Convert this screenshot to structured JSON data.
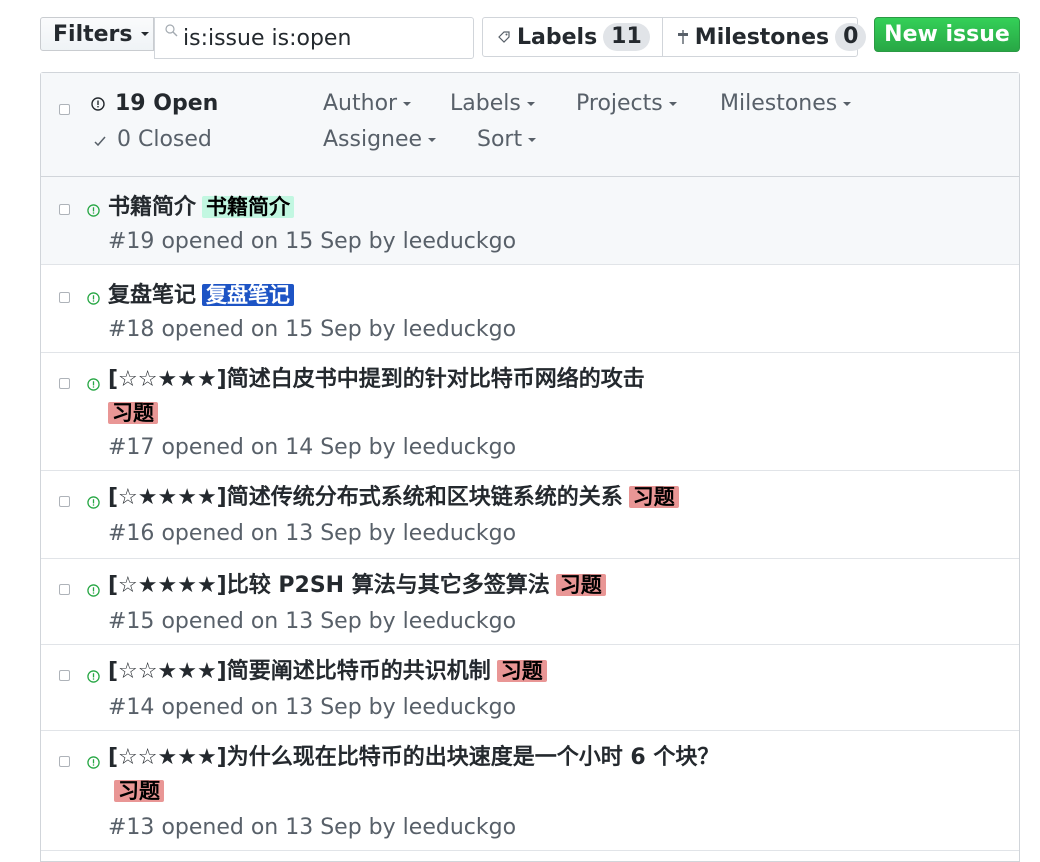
{
  "toolbar": {
    "filters_label": "Filters",
    "search_value": "is:issue is:open",
    "labels_label": "Labels",
    "labels_count": "11",
    "milestones_label": "Milestones",
    "milestones_count": "0",
    "new_issue_label": "New issue"
  },
  "header": {
    "open_label": "19 Open",
    "closed_label": "0 Closed",
    "filters": {
      "author": "Author",
      "labels": "Labels",
      "projects": "Projects",
      "milestones": "Milestones",
      "assignee": "Assignee",
      "sort": "Sort"
    }
  },
  "issues": [
    {
      "title": "书籍简介",
      "label": "书籍简介",
      "label_bg": "#c2f7e1",
      "label_fg": "#000000",
      "number": "#19",
      "opened": "opened on 15 Sep by",
      "author": "leeduckgo"
    },
    {
      "title": "复盘笔记",
      "label": "复盘笔记",
      "label_bg": "#1d54c5",
      "label_fg": "#ffffff",
      "number": "#18",
      "opened": "opened on 15 Sep by",
      "author": "leeduckgo"
    },
    {
      "title": "[☆☆★★★]简述白皮书中提到的针对比特币网络的攻击",
      "label": "习题",
      "label_bg": "#e99695",
      "label_fg": "#000000",
      "number": "#17",
      "opened": "opened on 14 Sep by",
      "author": "leeduckgo"
    },
    {
      "title": "[☆★★★★]简述传统分布式系统和区块链系统的关系",
      "label": "习题",
      "label_bg": "#e99695",
      "label_fg": "#000000",
      "number": "#16",
      "opened": "opened on 13 Sep by",
      "author": "leeduckgo"
    },
    {
      "title": "[☆★★★★]比较 P2SH 算法与其它多签算法",
      "label": "习题",
      "label_bg": "#e99695",
      "label_fg": "#000000",
      "number": "#15",
      "opened": "opened on 13 Sep by",
      "author": "leeduckgo"
    },
    {
      "title": "[☆☆★★★]简要阐述比特币的共识机制",
      "label": "习题",
      "label_bg": "#e99695",
      "label_fg": "#000000",
      "number": "#14",
      "opened": "opened on 13 Sep by",
      "author": "leeduckgo"
    },
    {
      "title": "[☆☆★★★]为什么现在比特币的出块速度是一个小时 6 个块？",
      "label": "习题",
      "label_bg": "#e99695",
      "label_fg": "#000000",
      "number": "#13",
      "opened": "opened on 13 Sep by",
      "author": "leeduckgo"
    }
  ],
  "icons": {
    "search": "search-icon",
    "tag": "tag-icon",
    "milestone": "milestone-icon",
    "open_issue": "issue-opened-icon",
    "check": "check-icon",
    "caret": "caret-down-icon"
  },
  "colors": {
    "open_green": "#28a745",
    "new_issue_green": "#28a745",
    "header_bg": "#f6f8fa",
    "border": "#d1d5da"
  }
}
